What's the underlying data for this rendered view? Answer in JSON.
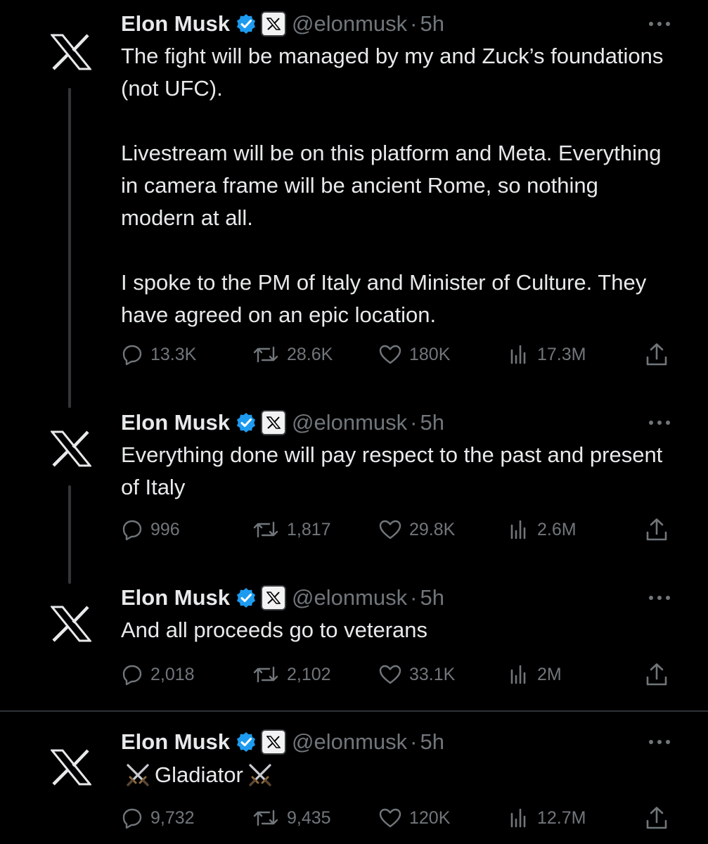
{
  "tweets": [
    {
      "name": "Elon Musk",
      "handle": "@elonmusk",
      "separator": "·",
      "time": "5h",
      "paragraphs": [
        "The fight will be managed by my and Zuck’s foundations (not UFC).",
        "Livestream will be on this platform and Meta. Everything in camera frame will be ancient Rome, so nothing modern at all.",
        "I spoke to the PM of Italy and Minister of Culture. They have agreed on an epic location."
      ],
      "replies": "13.3K",
      "reposts": "28.6K",
      "likes": "180K",
      "views": "17.3M"
    },
    {
      "name": "Elon Musk",
      "handle": "@elonmusk",
      "separator": "·",
      "time": "5h",
      "paragraphs": [
        "Everything done will pay respect to the past and present of Italy"
      ],
      "replies": "996",
      "reposts": "1,817",
      "likes": "29.8K",
      "views": "2.6M"
    },
    {
      "name": "Elon Musk",
      "handle": "@elonmusk",
      "separator": "·",
      "time": "5h",
      "paragraphs": [
        "And all proceeds go to veterans"
      ],
      "replies": "2,018",
      "reposts": "2,102",
      "likes": "33.1K",
      "views": "2M"
    },
    {
      "name": "Elon Musk",
      "handle": "@elonmusk",
      "separator": "·",
      "time": "5h",
      "text_word": "Gladiator",
      "text_emoji": "crossed-swords-icon",
      "replies": "9,732",
      "reposts": "9,435",
      "likes": "120K",
      "views": "12.7M"
    }
  ],
  "icons": {
    "avatar": "x-logo-icon",
    "verified": "verified-badge-icon",
    "affiliate": "x-affiliate-badge-icon",
    "more": "more-icon",
    "reply": "reply-icon",
    "repost": "repost-icon",
    "like": "heart-icon",
    "views": "views-icon",
    "share": "share-icon"
  },
  "colors": {
    "background": "#000000",
    "text": "#e7e9ea",
    "muted": "#71767b",
    "verified": "#1d9bf0",
    "thread_line": "#333639"
  }
}
